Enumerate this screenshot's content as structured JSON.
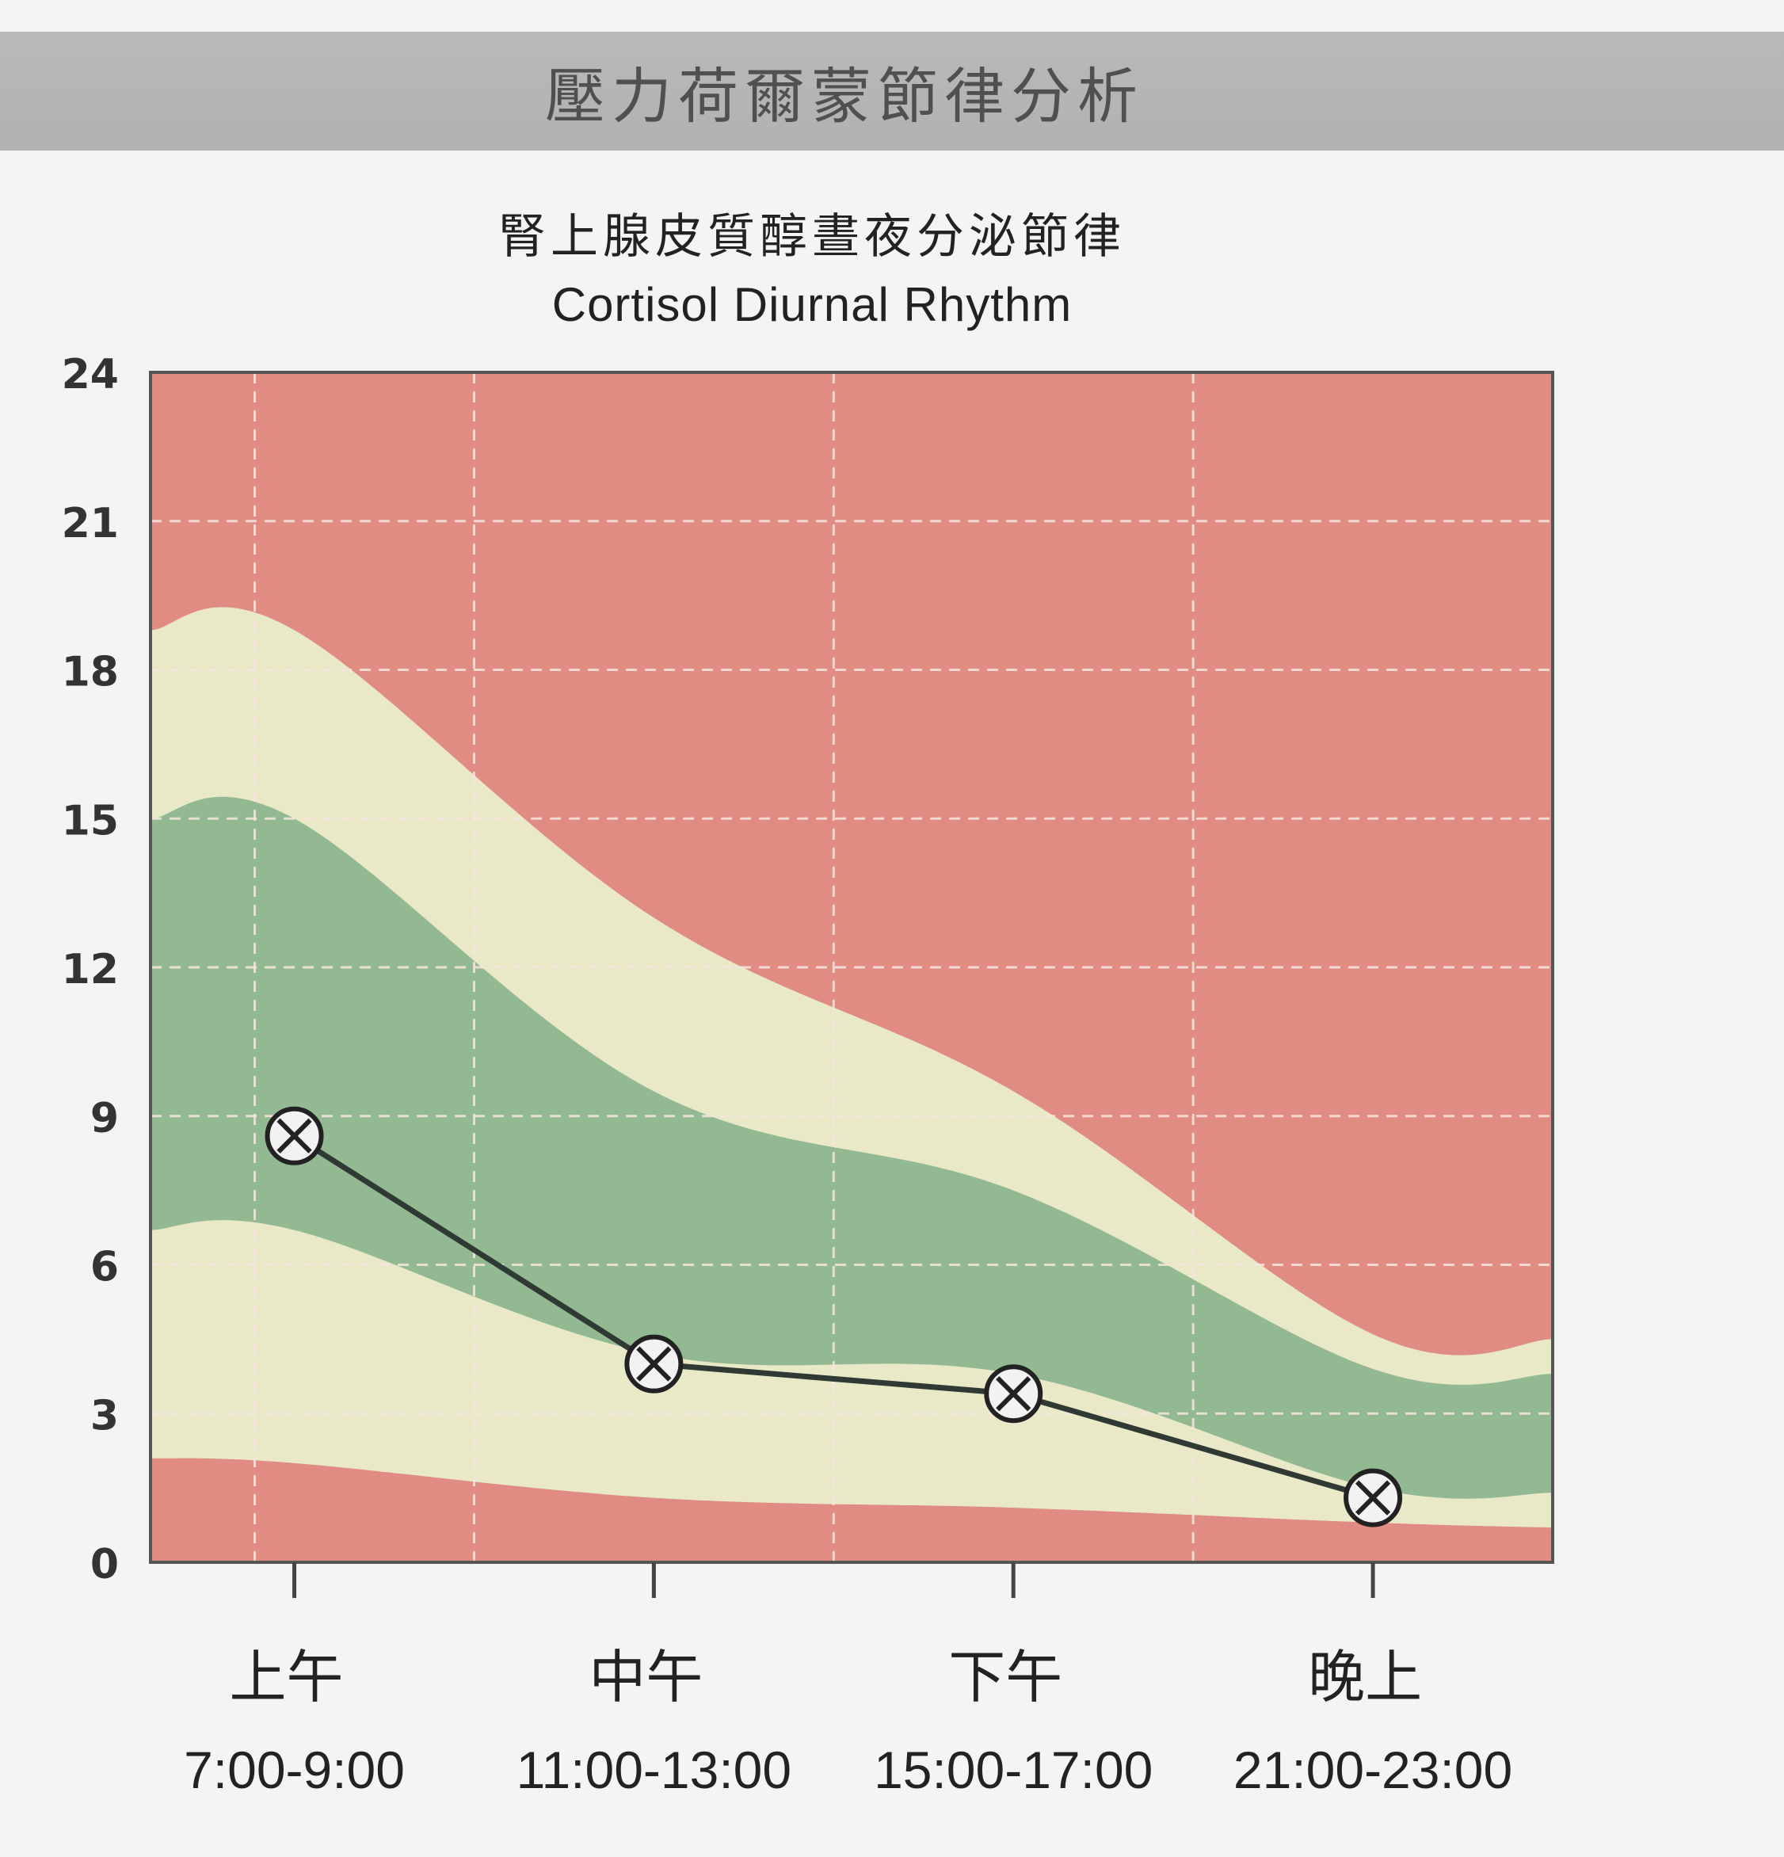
{
  "banner": {
    "title": "壓力荷爾蒙節律分析"
  },
  "chart_data": {
    "type": "line",
    "title": "腎上腺皮質醇晝夜分泌節律",
    "subtitle": "Cortisol Diurnal Rhythm",
    "ylim": [
      0,
      24
    ],
    "yticks": [
      "0",
      "3",
      "6",
      "9",
      "12",
      "15",
      "18",
      "21",
      "24"
    ],
    "categories": [
      {
        "label": "上午",
        "sublabel": "7:00-9:00"
      },
      {
        "label": "中午",
        "sublabel": "11:00-13:00"
      },
      {
        "label": "下午",
        "sublabel": "15:00-17:00"
      },
      {
        "label": "晚上",
        "sublabel": "21:00-23:00"
      }
    ],
    "x": [
      1,
      2,
      3,
      4
    ],
    "xlim": [
      0.6,
      4.5
    ],
    "grid": true,
    "series": [
      {
        "values": [
          8.6,
          4.0,
          3.4,
          1.3
        ],
        "color": "#2f3a34",
        "marker": "circle-x"
      }
    ],
    "bands": {
      "x": [
        0.6,
        1.0,
        2.0,
        3.0,
        4.0,
        4.5
      ],
      "lower_red_top": [
        2.1,
        2.0,
        1.3,
        1.1,
        0.8,
        0.7
      ],
      "lower_yellow_top": [
        6.7,
        6.7,
        4.2,
        3.8,
        1.5,
        1.4
      ],
      "green_top": [
        15.0,
        15.0,
        9.5,
        7.5,
        3.9,
        3.8
      ],
      "upper_yellow_top": [
        18.8,
        18.8,
        13.0,
        9.5,
        4.6,
        4.5
      ]
    },
    "colors": {
      "red": "#e08c82",
      "yellow": "#e9e9c8",
      "green": "#93b993",
      "grid": "#f7e6e0",
      "line": "#2f3a34"
    }
  }
}
